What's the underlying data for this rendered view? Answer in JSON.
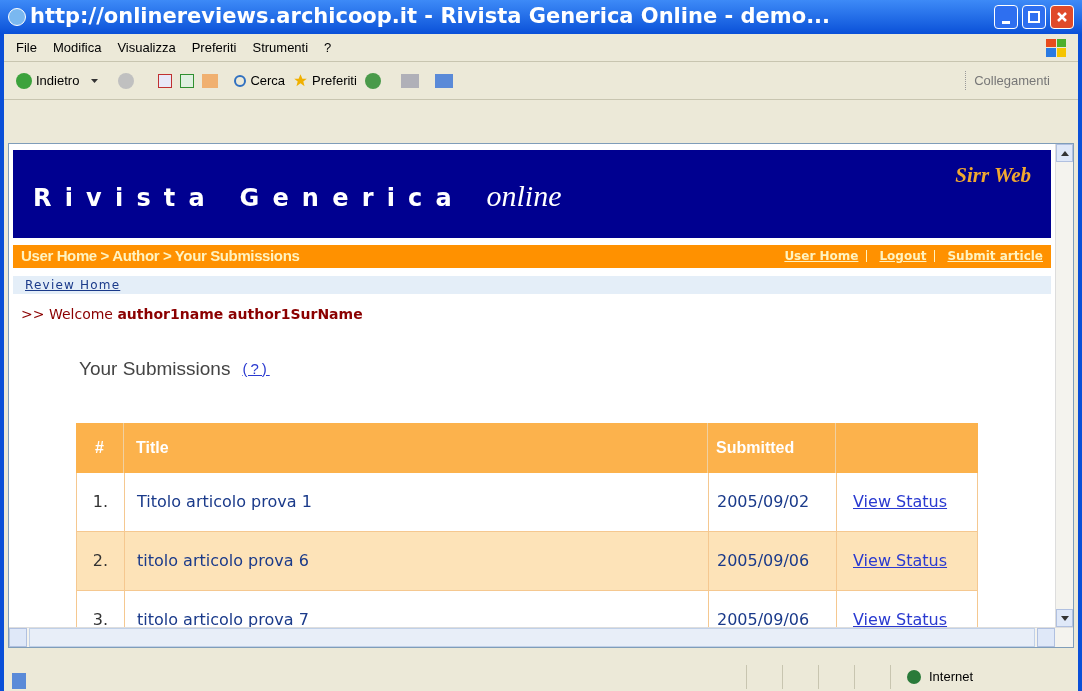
{
  "window": {
    "title": "http://onlinereviews.archicoop.it - Rivista Generica Online - demo..."
  },
  "menu": [
    "File",
    "Modifica",
    "Visualizza",
    "Preferiti",
    "Strumenti",
    "?"
  ],
  "toolbar": {
    "back": "Indietro",
    "search": "Cerca",
    "favorites": "Preferiti",
    "links": "Collegamenti"
  },
  "page": {
    "site_title": "Rivista Generica",
    "site_title_italic": "online",
    "brand": "Sirr Web",
    "breadcrumb": "User Home > Author > Your Submissions",
    "nav_links": [
      "User Home",
      "Logout",
      "Submit article"
    ],
    "review_home": "Review Home",
    "welcome_prefix": ">> Welcome",
    "welcome_name": "author1name author1SurName",
    "heading": "Your Submissions",
    "help": "(?)",
    "table": {
      "columns": [
        "#",
        "Title",
        "Submitted"
      ],
      "rows": [
        {
          "number": "1.",
          "title": "Titolo articolo prova 1",
          "submitted": "2005/09/02",
          "action": "View Status"
        },
        {
          "number": "2.",
          "title": "titolo articolo prova 6",
          "submitted": "2005/09/06",
          "action": "View Status"
        },
        {
          "number": "3.",
          "title": "titolo articolo prova 7",
          "submitted": "2005/09/06",
          "action": "View Status"
        }
      ]
    }
  },
  "status_bar": {
    "zone": "Internet"
  }
}
